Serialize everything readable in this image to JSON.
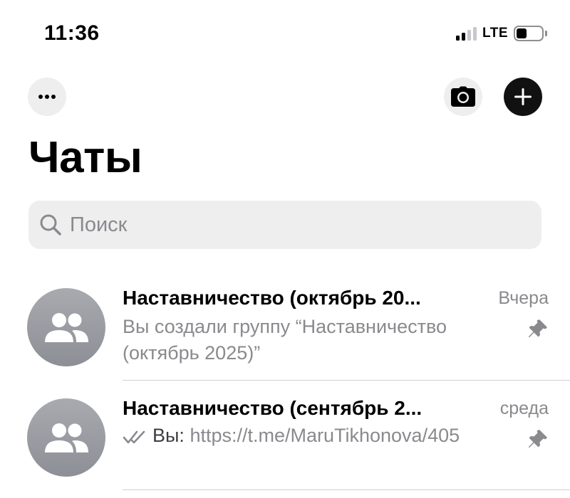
{
  "status": {
    "time": "11:36",
    "network": "LTE",
    "signal_bars_active": 2,
    "battery_level": 0.4
  },
  "header": {
    "title": "Чаты",
    "more_icon": "ellipsis-icon",
    "camera_icon": "camera-icon",
    "compose_icon": "plus-icon"
  },
  "search": {
    "placeholder": "Поиск",
    "icon": "search-icon"
  },
  "chats": [
    {
      "title": "Наставничество (октябрь 20...",
      "date": "Вчера",
      "preview": "Вы создали группу “Наставничество (октябрь 2025)”",
      "pinned": true,
      "avatar_icon": "group-icon"
    },
    {
      "title": "Наставничество (сентябрь 2...",
      "date": "среда",
      "preview_sender": "Вы:",
      "preview": "https://t.me/MaruTikhonova/405",
      "read_status": "double-check-icon",
      "pinned": true,
      "avatar_icon": "group-icon"
    }
  ],
  "colors": {
    "secondary_text": "#8a8a8e",
    "button_bg": "#eeeeef",
    "compose_bg": "#111111",
    "avatar_bg": "#9c9da3"
  }
}
